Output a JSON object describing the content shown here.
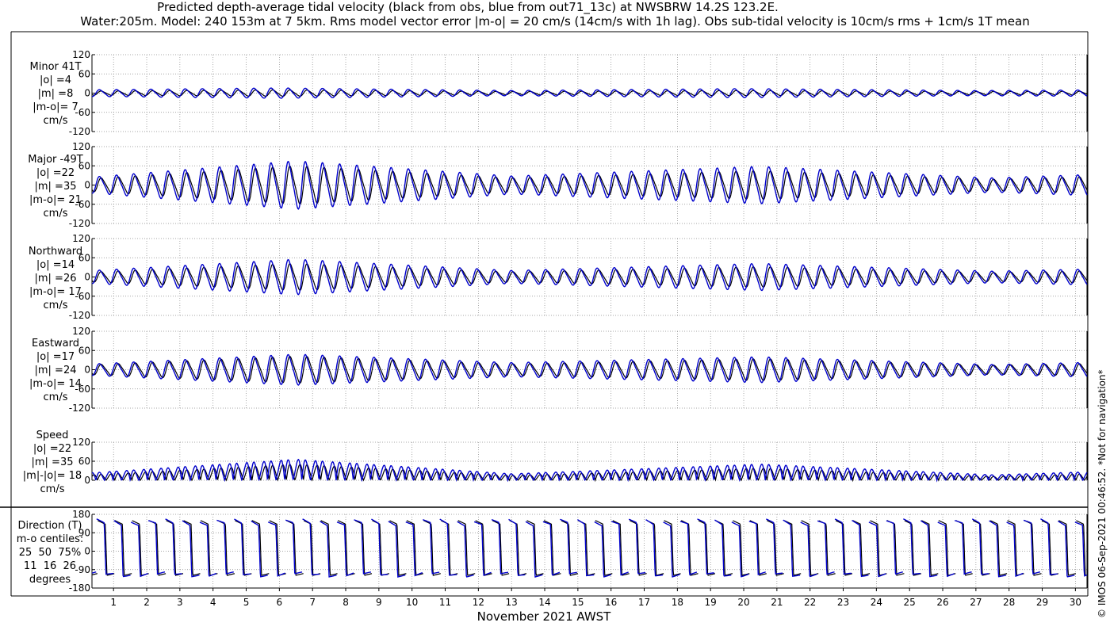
{
  "title_line1": "Predicted depth-average tidal velocity (black from obs, blue from out71_13c) at NWSBRW 14.2S 123.2E.",
  "title_line2": "Water:205m. Model: 240 153m at 7 5km. Rms model vector error |m-o| = 20 cm/s (14cm/s with 1h lag). Obs sub-tidal velocity is 10cm/s rms + 1cm/s 1T mean",
  "xlabel": "November 2021 AWST",
  "credit": "© IMOS 06-Sep-2021 00:46:52. *Not for navigation*",
  "colors": {
    "obs": "#000000",
    "model": "#0000cc",
    "grid": "#888888"
  },
  "panels": [
    {
      "label": "Minor 41T\n|o| =4\n|m| =8\n|m-o|= 7\ncm/s",
      "yticks": [
        "120",
        "60",
        "0",
        "-60",
        "-120"
      ]
    },
    {
      "label": "Major -49T\n|o| =22\n|m| =35\n|m-o|= 21\ncm/s",
      "yticks": [
        "120",
        "60",
        "0",
        "-60",
        "-120"
      ]
    },
    {
      "label": "Northward\n|o| =14\n|m| =26\n|m-o|= 17\ncm/s",
      "yticks": [
        "120",
        "60",
        "0",
        "-60",
        "-120"
      ]
    },
    {
      "label": "Eastward\n|o| =17\n|m| =24\n|m-o|= 14\ncm/s",
      "yticks": [
        "120",
        "60",
        "0",
        "-60",
        "-120"
      ]
    },
    {
      "label": "Speed\n|o| =22\n|m| =35\n|m|-|o|= 18\ncm/s",
      "yticks": [
        "120",
        "60",
        "0"
      ]
    },
    {
      "label": "Direction (T)\nm-o centiles:\n25  50  75%\n11  16  26\ndegrees",
      "yticks": [
        "180",
        "90",
        "0",
        "-90",
        "-180"
      ]
    }
  ],
  "chart_data": {
    "type": "line",
    "title": "Predicted depth-average tidal velocity (black from obs, blue from out71_13c) at NWSBRW 14.2S 123.2E.",
    "xlabel": "November 2021 AWST",
    "x_ticks": [
      "1",
      "2",
      "3",
      "4",
      "5",
      "6",
      "7",
      "8",
      "9",
      "10",
      "11",
      "12",
      "13",
      "14",
      "15",
      "16",
      "17",
      "18",
      "19",
      "20",
      "21",
      "22",
      "23",
      "24",
      "25",
      "26",
      "27",
      "28",
      "29",
      "30"
    ],
    "xlim_days": [
      0.35,
      30.35
    ],
    "tidal_period_days": 0.5175,
    "series": [
      {
        "name": "obs",
        "color": "black"
      },
      {
        "name": "out71_13c",
        "color": "blue"
      }
    ],
    "subplots": [
      {
        "ylabel": "Minor 41T",
        "ylim": [
          -120,
          120
        ],
        "obs_rms": 4,
        "model_rms": 8,
        "diff_rms": 7,
        "amp_envelope": {
          "x": [
            0,
            6,
            13,
            20,
            27,
            31
          ],
          "obs": [
            6,
            10,
            5,
            8,
            5,
            6
          ],
          "model": [
            10,
            16,
            8,
            14,
            8,
            10
          ]
        }
      },
      {
        "ylabel": "Major -49T",
        "ylim": [
          -120,
          120
        ],
        "obs_rms": 22,
        "model_rms": 35,
        "diff_rms": 21,
        "amp_envelope": {
          "x": [
            0,
            6.5,
            13,
            20.5,
            27.5,
            31
          ],
          "obs": [
            18,
            60,
            22,
            45,
            18,
            28
          ],
          "model": [
            22,
            75,
            28,
            58,
            22,
            35
          ]
        }
      },
      {
        "ylabel": "Northward",
        "ylim": [
          -120,
          120
        ],
        "obs_rms": 14,
        "model_rms": 26,
        "diff_rms": 17,
        "amp_envelope": {
          "x": [
            0,
            6.5,
            13,
            20.5,
            27.5,
            31
          ],
          "obs": [
            14,
            42,
            16,
            32,
            14,
            20
          ],
          "model": [
            18,
            55,
            20,
            42,
            18,
            26
          ]
        }
      },
      {
        "ylabel": "Eastward",
        "ylim": [
          -120,
          120
        ],
        "obs_rms": 17,
        "model_rms": 24,
        "diff_rms": 14,
        "amp_envelope": {
          "x": [
            0,
            6.5,
            13,
            20.5,
            27.5,
            31
          ],
          "obs": [
            14,
            42,
            18,
            34,
            14,
            20
          ],
          "model": [
            16,
            48,
            22,
            40,
            16,
            24
          ]
        }
      },
      {
        "ylabel": "Speed",
        "ylim": [
          0,
          120
        ],
        "obs_rms": 22,
        "model_rms": 35,
        "diff_rms": 18,
        "amp_envelope": {
          "x": [
            0,
            6.5,
            13,
            20.5,
            27.5,
            31
          ],
          "obs": [
            18,
            60,
            18,
            45,
            14,
            26
          ],
          "model": [
            25,
            78,
            24,
            60,
            20,
            34
          ]
        }
      },
      {
        "ylabel": "Direction (T)",
        "ylim": [
          -180,
          180
        ],
        "centiles_25_50_75": [
          11,
          16,
          26
        ]
      }
    ]
  }
}
